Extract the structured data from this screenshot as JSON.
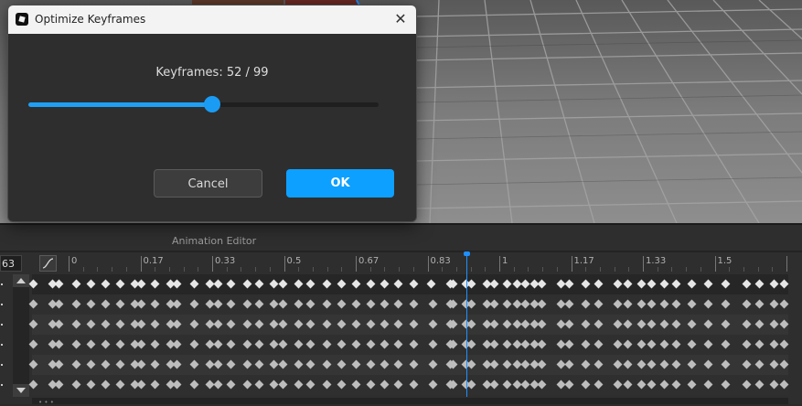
{
  "dialog": {
    "title": "Optimize Keyframes",
    "close_glyph": "✕",
    "keyframes_label": "Keyframes: 52 / 99",
    "slider_value": 52,
    "slider_max": 99,
    "cancel_label": "Cancel",
    "ok_label": "OK",
    "accent_color": "#0ea0ff"
  },
  "animation_editor": {
    "title": "Animation Editor",
    "frame_value": "63",
    "timeline_labels": [
      "0",
      "0.17",
      "0.33",
      "0.5",
      "0.67",
      "0.83",
      "1",
      "1.17",
      "1.33",
      "1.5"
    ],
    "playhead_color": "#1e90ff"
  },
  "icons": {
    "app": "roblox-studio-icon",
    "close": "close-icon",
    "curve": "curve-editor-icon",
    "scroll_up": "scroll-up-arrow-icon",
    "scroll_down": "scroll-down-arrow-icon"
  }
}
